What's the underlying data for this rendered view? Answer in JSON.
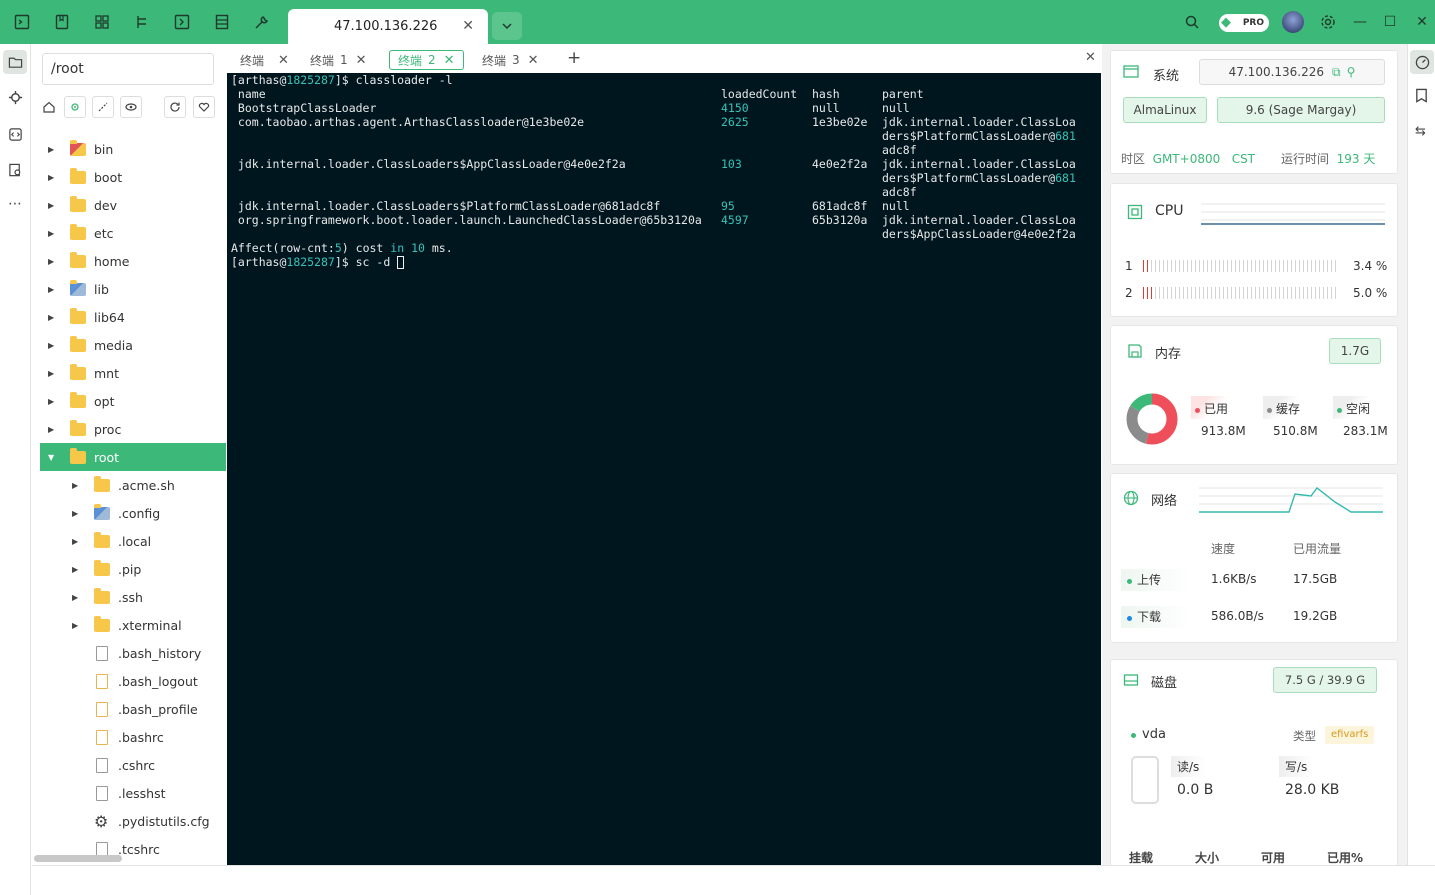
{
  "topbar": {
    "active_tab": "47.100.136.226",
    "pro_badge": "PRO"
  },
  "files": {
    "path": "/root",
    "items": [
      {
        "name": "bin",
        "kind": "folder-special",
        "depth": 0,
        "expandable": true
      },
      {
        "name": "boot",
        "kind": "folder",
        "depth": 0,
        "expandable": true
      },
      {
        "name": "dev",
        "kind": "folder",
        "depth": 0,
        "expandable": true
      },
      {
        "name": "etc",
        "kind": "folder",
        "depth": 0,
        "expandable": true
      },
      {
        "name": "home",
        "kind": "folder",
        "depth": 0,
        "expandable": true
      },
      {
        "name": "lib",
        "kind": "folder-special",
        "depth": 0,
        "expandable": true
      },
      {
        "name": "lib64",
        "kind": "folder",
        "depth": 0,
        "expandable": true
      },
      {
        "name": "media",
        "kind": "folder",
        "depth": 0,
        "expandable": true
      },
      {
        "name": "mnt",
        "kind": "folder",
        "depth": 0,
        "expandable": true
      },
      {
        "name": "opt",
        "kind": "folder",
        "depth": 0,
        "expandable": true
      },
      {
        "name": "proc",
        "kind": "folder",
        "depth": 0,
        "expandable": true
      },
      {
        "name": "root",
        "kind": "folder",
        "depth": 0,
        "expandable": true,
        "selected": true
      },
      {
        "name": ".acme.sh",
        "kind": "folder",
        "depth": 1,
        "expandable": true
      },
      {
        "name": ".config",
        "kind": "folder-special",
        "depth": 1,
        "expandable": true
      },
      {
        "name": ".local",
        "kind": "folder",
        "depth": 1,
        "expandable": true
      },
      {
        "name": ".pip",
        "kind": "folder",
        "depth": 1,
        "expandable": true
      },
      {
        "name": ".ssh",
        "kind": "folder",
        "depth": 1,
        "expandable": true
      },
      {
        "name": ".xterminal",
        "kind": "folder",
        "depth": 1,
        "expandable": true
      },
      {
        "name": ".bash_history",
        "kind": "file",
        "depth": 1
      },
      {
        "name": ".bash_logout",
        "kind": "file-y",
        "depth": 1
      },
      {
        "name": ".bash_profile",
        "kind": "file-y",
        "depth": 1
      },
      {
        "name": ".bashrc",
        "kind": "file-y",
        "depth": 1
      },
      {
        "name": ".cshrc",
        "kind": "file",
        "depth": 1
      },
      {
        "name": ".lesshst",
        "kind": "file",
        "depth": 1
      },
      {
        "name": ".pydistutils.cfg",
        "kind": "gear",
        "depth": 1
      },
      {
        "name": ".tcshrc",
        "kind": "file",
        "depth": 1
      }
    ]
  },
  "term_tabs": [
    {
      "label": "终端",
      "num": ""
    },
    {
      "label": "终端",
      "num": "1"
    },
    {
      "label": "终端",
      "num": "2",
      "active": true
    },
    {
      "label": "终端",
      "num": "3"
    }
  ],
  "terminal": {
    "lines": [
      [
        {
          "t": "[arthas@"
        },
        {
          "t": "1825287",
          "c": "cy"
        },
        {
          "t": "]$ classloader -l"
        }
      ],
      [
        {
          "t": " name"
        }
      ],
      [
        {
          "t": " BootstrapClassLoader"
        }
      ],
      [
        {
          "t": " com.taobao.arthas.agent.ArthasClassloader@1e3be02e"
        }
      ],
      [],
      [],
      [
        {
          "t": " jdk.internal.loader.ClassLoaders$AppClassLoader@4e0e2f2a"
        }
      ],
      [],
      [],
      [
        {
          "t": " jdk.internal.loader.ClassLoaders$PlatformClassLoader@681adc8f"
        }
      ],
      [
        {
          "t": " org.springframework.boot.loader.launch.LaunchedClassLoader@65b3120a"
        }
      ],
      [],
      [
        {
          "t": "Affect(row-cnt:"
        },
        {
          "t": "5",
          "c": "cy"
        },
        {
          "t": ") cost "
        },
        {
          "t": "in",
          "c": "cy"
        },
        {
          "t": " "
        },
        {
          "t": "10",
          "c": "cy"
        },
        {
          "t": " ms."
        }
      ],
      [
        {
          "t": "[arthas@"
        },
        {
          "t": "1825287",
          "c": "cy"
        },
        {
          "t": "]$ sc -d "
        }
      ]
    ],
    "col_loaded": [
      {
        "row": 1,
        "t": "loadedCount"
      },
      {
        "row": 2,
        "t": "4150",
        "c": "cy"
      },
      {
        "row": 3,
        "t": "2625",
        "c": "cy"
      },
      {
        "row": 6,
        "t": "103",
        "c": "cy"
      },
      {
        "row": 9,
        "t": "95",
        "c": "cy"
      },
      {
        "row": 10,
        "t": "4597",
        "c": "cy"
      }
    ],
    "col_hash": [
      {
        "row": 1,
        "t": "hash"
      },
      {
        "row": 2,
        "t": "null"
      },
      {
        "row": 3,
        "t": "1e3be02e"
      },
      {
        "row": 6,
        "t": "4e0e2f2a"
      },
      {
        "row": 9,
        "t": "681adc8f"
      },
      {
        "row": 10,
        "t": "65b3120a"
      }
    ],
    "col_parent": [
      [
        {
          "t": "parent"
        }
      ],
      [
        {
          "t": "null"
        }
      ],
      [
        {
          "t": "jdk.internal.loader.ClassLoa"
        }
      ],
      [
        {
          "t": "ders$PlatformClassLoader@"
        },
        {
          "t": "681",
          "c": "cy"
        }
      ],
      [
        {
          "t": "adc8f"
        }
      ],
      [
        {
          "t": "jdk.internal.loader.ClassLoa"
        }
      ],
      [
        {
          "t": "ders$PlatformClassLoader@"
        },
        {
          "t": "681",
          "c": "cy"
        }
      ],
      [
        {
          "t": "adc8f"
        }
      ],
      [
        {
          "t": "null"
        }
      ],
      [
        {
          "t": "jdk.internal.loader.ClassLoa"
        }
      ],
      [
        {
          "t": "ders$AppClassLoader@4e0e2f2a"
        }
      ]
    ]
  },
  "system": {
    "title": "系统",
    "ip": "47.100.136.226",
    "os": "AlmaLinux",
    "version": "9.6 (Sage Margay)",
    "tz_label": "时区",
    "tz_value": "GMT+0800",
    "tz_name": "CST",
    "uptime_label": "运行时间",
    "uptime_value": "193 天"
  },
  "cpu": {
    "title": "CPU",
    "cores": [
      {
        "id": "1",
        "usage": 0.034,
        "text": "3.4 %"
      },
      {
        "id": "2",
        "usage": 0.05,
        "text": "5.0 %"
      }
    ]
  },
  "memory": {
    "title": "内存",
    "total": "1.7G",
    "segments": [
      {
        "label": "已用",
        "value": "913.8M",
        "color": "#ef4f5b",
        "fraction": 0.537
      },
      {
        "label": "缓存",
        "value": "510.8M",
        "color": "#8b8b8b",
        "fraction": 0.3
      },
      {
        "label": "空闲",
        "value": "283.1M",
        "color": "#3cb878",
        "fraction": 0.163
      }
    ]
  },
  "network": {
    "title": "网络",
    "col_speed": "速度",
    "col_used": "已用流量",
    "rows": [
      {
        "label": "上传",
        "speed": "1.6KB/s",
        "used": "17.5GB",
        "color": "#3cb878"
      },
      {
        "label": "下载",
        "speed": "586.0B/s",
        "used": "19.2GB",
        "color": "#1e88e5"
      }
    ]
  },
  "disk": {
    "title": "磁盘",
    "usage": "7.5 G / 39.9 G",
    "device": "vda",
    "type_label": "类型",
    "type_value": "efivarfs",
    "read_label": "读/s",
    "read_value": "0.0 B",
    "write_label": "写/s",
    "write_value": "28.0 KB",
    "cols": [
      "挂载",
      "大小",
      "可用",
      "已用%"
    ]
  }
}
